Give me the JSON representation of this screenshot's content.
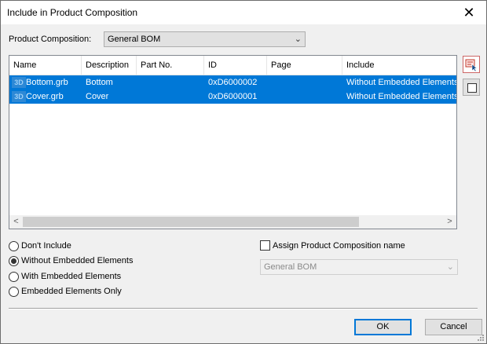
{
  "window": {
    "title": "Include in Product Composition",
    "close_glyph": "✕"
  },
  "product_composition": {
    "label": "Product Composition:",
    "value": "General BOM"
  },
  "grid": {
    "columns": [
      "Name",
      "Description",
      "Part No.",
      "ID",
      "Page",
      "Include"
    ],
    "rows": [
      {
        "icon": "3D",
        "name": "Bottom.grb",
        "description": "Bottom",
        "part_no": "",
        "id": "0xD6000002",
        "page": "",
        "include": "Without Embedded Elements"
      },
      {
        "icon": "3D",
        "name": "Cover.grb",
        "description": "Cover",
        "part_no": "",
        "id": "0xD6000001",
        "page": "",
        "include": "Without Embedded Elements"
      }
    ],
    "scroll_left": "<",
    "scroll_right": ">"
  },
  "options": {
    "items": [
      "Don't Include",
      "Without Embedded Elements",
      "With Embedded Elements",
      "Embedded Elements Only"
    ],
    "selected_index": 1
  },
  "assign": {
    "label": "Assign Product Composition name",
    "checked": false,
    "value": "General BOM"
  },
  "buttons": {
    "ok": "OK",
    "cancel": "Cancel"
  },
  "icons": {
    "side_top": "select-in-drawing-icon",
    "side_bottom": "checkbox-square-icon"
  },
  "colors": {
    "selection": "#0078d7",
    "default_button_border": "#0078d7",
    "dialog_bg": "#f0f0f0"
  }
}
